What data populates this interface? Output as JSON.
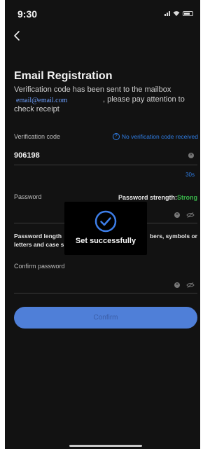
{
  "status_bar": {
    "time": "9:30"
  },
  "header": {
    "title": "Email Registration"
  },
  "description": {
    "line1": "Verification code has been sent to the mailbox",
    "email": "email@email.com",
    "line2": ", please pay attention to",
    "line3": "check receipt"
  },
  "verification": {
    "label": "Verification code",
    "no_code_link": "No verification code received",
    "value": "906198",
    "countdown": "30s"
  },
  "password": {
    "label": "Password",
    "strength_label": "Password strength:",
    "strength_value": "Strong",
    "hint_line1_left": "Password length",
    "hint_line1_right": "bers, symbols or",
    "hint_line2": "letters and case s"
  },
  "confirm_password": {
    "label": "Confirm password"
  },
  "confirm_button": {
    "label": "Confirm"
  },
  "toast": {
    "text": "Set successfully"
  },
  "colors": {
    "accent": "#2f7ee6",
    "button": "#4f7fd8",
    "strong": "#39b54a",
    "background": "#121212"
  }
}
